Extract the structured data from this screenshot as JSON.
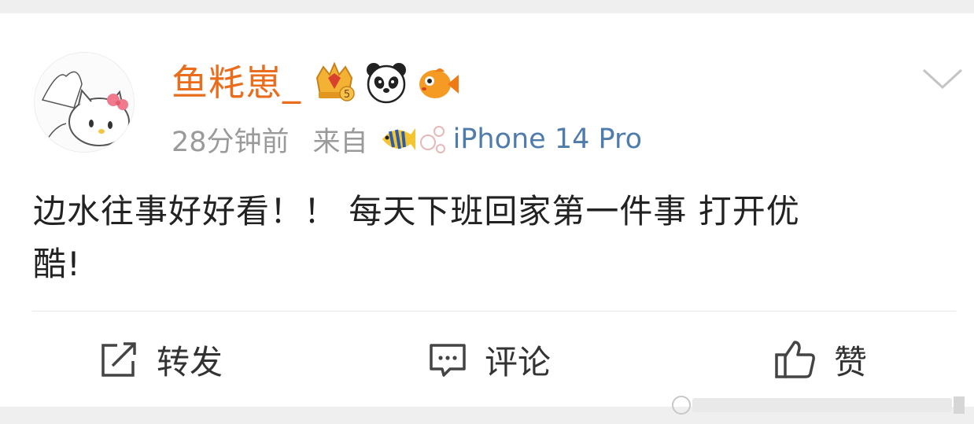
{
  "post": {
    "user": {
      "name": "鱼粍崽_",
      "avatar": "hello-kitty-avatar",
      "badges": [
        "crown-level-5-badge",
        "panda-badge",
        "goldfish-badge"
      ]
    },
    "time": "28分钟前",
    "source_prefix": "来自",
    "device": "iPhone 14 Pro",
    "device_icons": [
      "tropical-fish-icon",
      "bubbles-icon"
    ],
    "text_line1": "边水往事好好看！！ 每天下班回家第一件事 打开优",
    "text_line2": "酷!",
    "menu_icon": "chevron-down-icon"
  },
  "actions": {
    "repost": {
      "label": "转发",
      "icon": "share-icon"
    },
    "comment": {
      "label": "评论",
      "icon": "comment-icon"
    },
    "like": {
      "label": "赞",
      "icon": "thumbs-up-icon"
    }
  },
  "colors": {
    "username": "#ea6d1e",
    "meta": "#9a9a9a",
    "device": "#4f7cac",
    "text": "#222222",
    "background": "#efefef"
  }
}
